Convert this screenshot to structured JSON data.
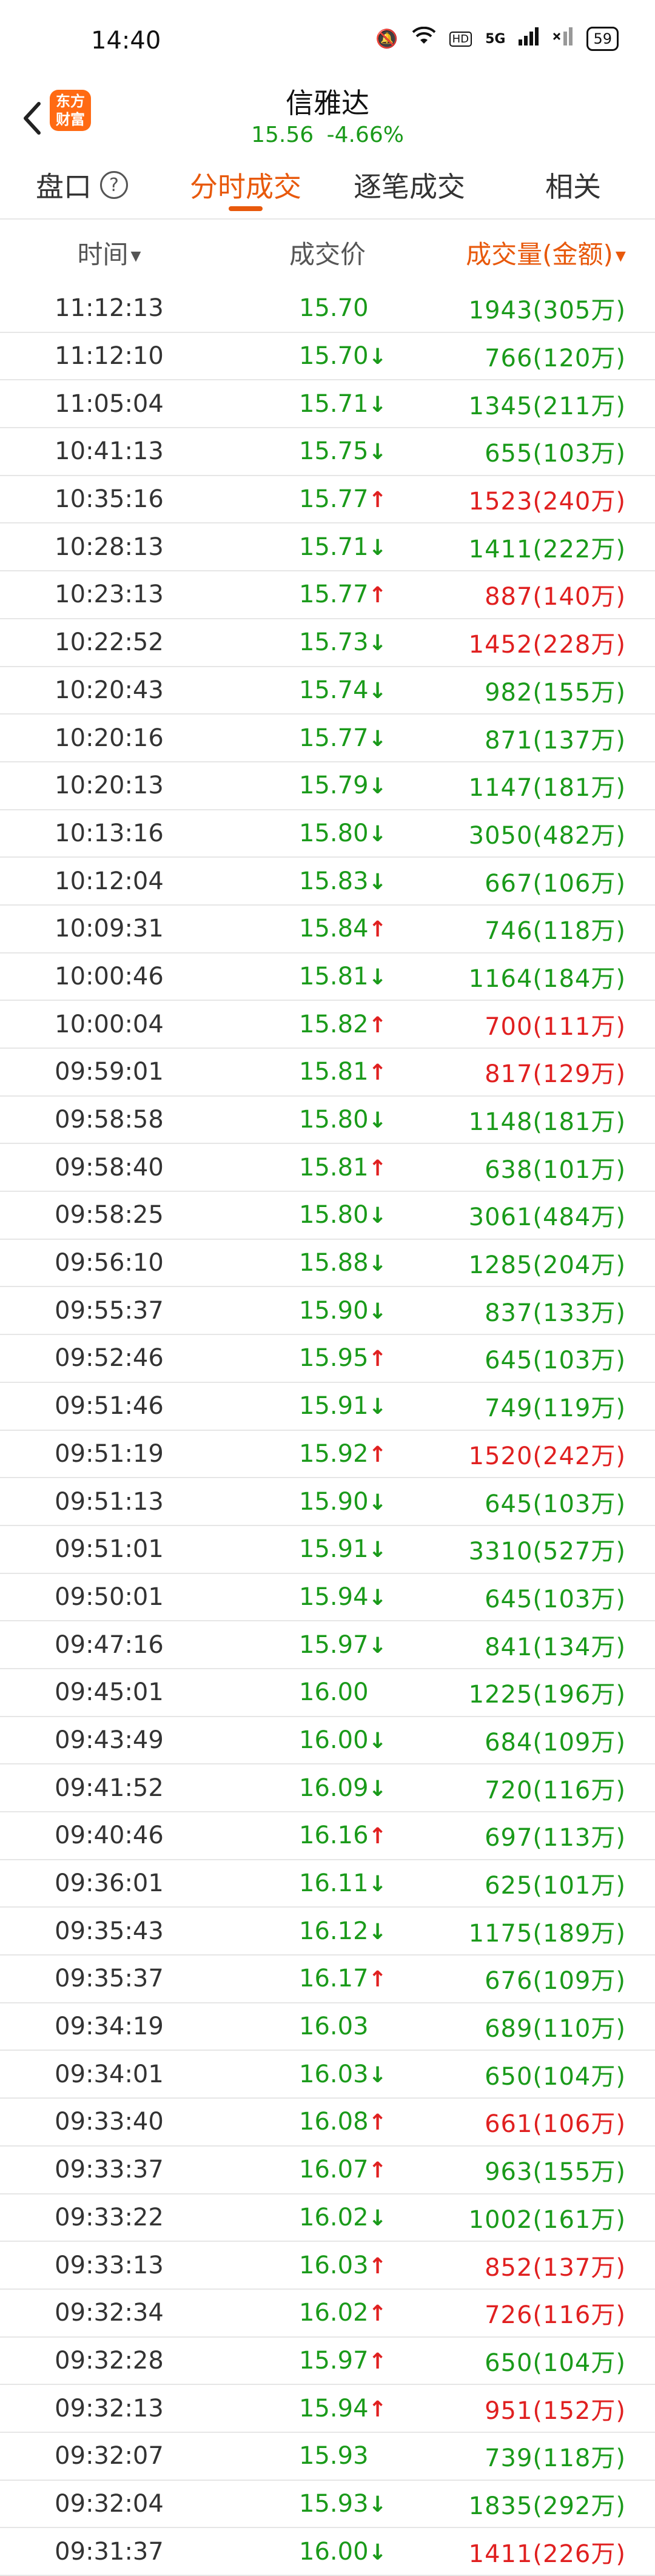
{
  "status": {
    "time": "14:40",
    "battery": "59",
    "network": "5G"
  },
  "header": {
    "stock_name": "信雅达",
    "price": "15.56",
    "change": "-4.66%",
    "logo_line1": "东方",
    "logo_line2": "财富"
  },
  "tabs": [
    {
      "label": "盘口"
    },
    {
      "label": "分时成交"
    },
    {
      "label": "逐笔成交"
    },
    {
      "label": "相关"
    }
  ],
  "columns": {
    "time": "时间",
    "price": "成交价",
    "volume": "成交量(金额)"
  },
  "colors": {
    "up": "#e02020",
    "down": "#1a9a1a",
    "accent": "#e8590c"
  },
  "rows": [
    {
      "time": "11:12:13",
      "price": "15.70",
      "dir": "",
      "vol": "1943",
      "amt": "305万",
      "vcolor": "green"
    },
    {
      "time": "11:12:10",
      "price": "15.70",
      "dir": "down",
      "vol": "766",
      "amt": "120万",
      "vcolor": "green"
    },
    {
      "time": "11:05:04",
      "price": "15.71",
      "dir": "down",
      "vol": "1345",
      "amt": "211万",
      "vcolor": "green"
    },
    {
      "time": "10:41:13",
      "price": "15.75",
      "dir": "down",
      "vol": "655",
      "amt": "103万",
      "vcolor": "green"
    },
    {
      "time": "10:35:16",
      "price": "15.77",
      "dir": "up",
      "vol": "1523",
      "amt": "240万",
      "vcolor": "red"
    },
    {
      "time": "10:28:13",
      "price": "15.71",
      "dir": "down",
      "vol": "1411",
      "amt": "222万",
      "vcolor": "green"
    },
    {
      "time": "10:23:13",
      "price": "15.77",
      "dir": "up",
      "vol": "887",
      "amt": "140万",
      "vcolor": "red"
    },
    {
      "time": "10:22:52",
      "price": "15.73",
      "dir": "down",
      "vol": "1452",
      "amt": "228万",
      "vcolor": "red"
    },
    {
      "time": "10:20:43",
      "price": "15.74",
      "dir": "down",
      "vol": "982",
      "amt": "155万",
      "vcolor": "green"
    },
    {
      "time": "10:20:16",
      "price": "15.77",
      "dir": "down",
      "vol": "871",
      "amt": "137万",
      "vcolor": "green"
    },
    {
      "time": "10:20:13",
      "price": "15.79",
      "dir": "down",
      "vol": "1147",
      "amt": "181万",
      "vcolor": "green"
    },
    {
      "time": "10:13:16",
      "price": "15.80",
      "dir": "down",
      "vol": "3050",
      "amt": "482万",
      "vcolor": "green"
    },
    {
      "time": "10:12:04",
      "price": "15.83",
      "dir": "down",
      "vol": "667",
      "amt": "106万",
      "vcolor": "green"
    },
    {
      "time": "10:09:31",
      "price": "15.84",
      "dir": "up",
      "vol": "746",
      "amt": "118万",
      "vcolor": "green"
    },
    {
      "time": "10:00:46",
      "price": "15.81",
      "dir": "down",
      "vol": "1164",
      "amt": "184万",
      "vcolor": "green"
    },
    {
      "time": "10:00:04",
      "price": "15.82",
      "dir": "up",
      "vol": "700",
      "amt": "111万",
      "vcolor": "red"
    },
    {
      "time": "09:59:01",
      "price": "15.81",
      "dir": "up",
      "vol": "817",
      "amt": "129万",
      "vcolor": "red"
    },
    {
      "time": "09:58:58",
      "price": "15.80",
      "dir": "down",
      "vol": "1148",
      "amt": "181万",
      "vcolor": "green"
    },
    {
      "time": "09:58:40",
      "price": "15.81",
      "dir": "up",
      "vol": "638",
      "amt": "101万",
      "vcolor": "green"
    },
    {
      "time": "09:58:25",
      "price": "15.80",
      "dir": "down",
      "vol": "3061",
      "amt": "484万",
      "vcolor": "green"
    },
    {
      "time": "09:56:10",
      "price": "15.88",
      "dir": "down",
      "vol": "1285",
      "amt": "204万",
      "vcolor": "green"
    },
    {
      "time": "09:55:37",
      "price": "15.90",
      "dir": "down",
      "vol": "837",
      "amt": "133万",
      "vcolor": "green"
    },
    {
      "time": "09:52:46",
      "price": "15.95",
      "dir": "up",
      "vol": "645",
      "amt": "103万",
      "vcolor": "green"
    },
    {
      "time": "09:51:46",
      "price": "15.91",
      "dir": "down",
      "vol": "749",
      "amt": "119万",
      "vcolor": "green"
    },
    {
      "time": "09:51:19",
      "price": "15.92",
      "dir": "up",
      "vol": "1520",
      "amt": "242万",
      "vcolor": "red"
    },
    {
      "time": "09:51:13",
      "price": "15.90",
      "dir": "down",
      "vol": "645",
      "amt": "103万",
      "vcolor": "green"
    },
    {
      "time": "09:51:01",
      "price": "15.91",
      "dir": "down",
      "vol": "3310",
      "amt": "527万",
      "vcolor": "green"
    },
    {
      "time": "09:50:01",
      "price": "15.94",
      "dir": "down",
      "vol": "645",
      "amt": "103万",
      "vcolor": "green"
    },
    {
      "time": "09:47:16",
      "price": "15.97",
      "dir": "down",
      "vol": "841",
      "amt": "134万",
      "vcolor": "green"
    },
    {
      "time": "09:45:01",
      "price": "16.00",
      "dir": "",
      "vol": "1225",
      "amt": "196万",
      "vcolor": "green"
    },
    {
      "time": "09:43:49",
      "price": "16.00",
      "dir": "down",
      "vol": "684",
      "amt": "109万",
      "vcolor": "green"
    },
    {
      "time": "09:41:52",
      "price": "16.09",
      "dir": "down",
      "vol": "720",
      "amt": "116万",
      "vcolor": "green"
    },
    {
      "time": "09:40:46",
      "price": "16.16",
      "dir": "up",
      "vol": "697",
      "amt": "113万",
      "vcolor": "green"
    },
    {
      "time": "09:36:01",
      "price": "16.11",
      "dir": "down",
      "vol": "625",
      "amt": "101万",
      "vcolor": "green"
    },
    {
      "time": "09:35:43",
      "price": "16.12",
      "dir": "down",
      "vol": "1175",
      "amt": "189万",
      "vcolor": "green"
    },
    {
      "time": "09:35:37",
      "price": "16.17",
      "dir": "up",
      "vol": "676",
      "amt": "109万",
      "vcolor": "green"
    },
    {
      "time": "09:34:19",
      "price": "16.03",
      "dir": "",
      "vol": "689",
      "amt": "110万",
      "vcolor": "green"
    },
    {
      "time": "09:34:01",
      "price": "16.03",
      "dir": "down",
      "vol": "650",
      "amt": "104万",
      "vcolor": "green"
    },
    {
      "time": "09:33:40",
      "price": "16.08",
      "dir": "up",
      "vol": "661",
      "amt": "106万",
      "vcolor": "red"
    },
    {
      "time": "09:33:37",
      "price": "16.07",
      "dir": "up",
      "vol": "963",
      "amt": "155万",
      "vcolor": "green"
    },
    {
      "time": "09:33:22",
      "price": "16.02",
      "dir": "down",
      "vol": "1002",
      "amt": "161万",
      "vcolor": "green"
    },
    {
      "time": "09:33:13",
      "price": "16.03",
      "dir": "up",
      "vol": "852",
      "amt": "137万",
      "vcolor": "red"
    },
    {
      "time": "09:32:34",
      "price": "16.02",
      "dir": "up",
      "vol": "726",
      "amt": "116万",
      "vcolor": "red"
    },
    {
      "time": "09:32:28",
      "price": "15.97",
      "dir": "up",
      "vol": "650",
      "amt": "104万",
      "vcolor": "green"
    },
    {
      "time": "09:32:13",
      "price": "15.94",
      "dir": "up",
      "vol": "951",
      "amt": "152万",
      "vcolor": "red"
    },
    {
      "time": "09:32:07",
      "price": "15.93",
      "dir": "",
      "vol": "739",
      "amt": "118万",
      "vcolor": "green"
    },
    {
      "time": "09:32:04",
      "price": "15.93",
      "dir": "down",
      "vol": "1835",
      "amt": "292万",
      "vcolor": "green"
    },
    {
      "time": "09:31:37",
      "price": "16.00",
      "dir": "down",
      "vol": "1411",
      "amt": "226万",
      "vcolor": "red"
    }
  ]
}
